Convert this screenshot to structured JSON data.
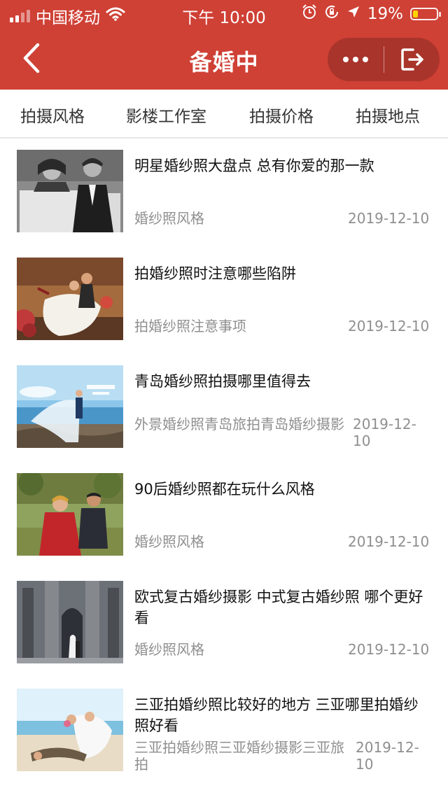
{
  "status_bar": {
    "carrier": "中国移动",
    "time": "下午 10:00",
    "battery": "19%"
  },
  "nav": {
    "title": "备婚中"
  },
  "tabs": [
    "拍摄风格",
    "影楼工作室",
    "拍摄价格",
    "拍摄地点"
  ],
  "articles": [
    {
      "title": "明星婚纱照大盘点 总有你爱的那一款",
      "tag": "婚纱照风格",
      "date": "2019-12-10"
    },
    {
      "title": "拍婚纱照时注意哪些陷阱",
      "tag": "拍婚纱照注意事项",
      "date": "2019-12-10"
    },
    {
      "title": "青岛婚纱照拍摄哪里值得去",
      "tag": "外景婚纱照青岛旅拍青岛婚纱摄影",
      "date": "2019-12-10"
    },
    {
      "title": "90后婚纱照都在玩什么风格",
      "tag": "婚纱照风格",
      "date": "2019-12-10"
    },
    {
      "title": "欧式复古婚纱摄影 中式复古婚纱照 哪个更好看",
      "tag": "婚纱照风格",
      "date": "2019-12-10"
    },
    {
      "title": "三亚拍婚纱照比较好的地方 三亚哪里拍婚纱照好看",
      "tag": "三亚拍婚纱照三亚婚纱摄影三亚旅拍",
      "date": "2019-12-10"
    }
  ],
  "colors": {
    "header": "#cf4035",
    "text_primary": "#111111",
    "text_secondary": "#8f8f8f",
    "battery_fill": "#ffd400"
  },
  "icons": [
    "signal-icon",
    "wifi-icon",
    "alarm-icon",
    "orientation-lock-icon",
    "location-arrow-icon",
    "battery-icon",
    "back-chevron-icon",
    "more-dots-icon",
    "exit-icon"
  ]
}
